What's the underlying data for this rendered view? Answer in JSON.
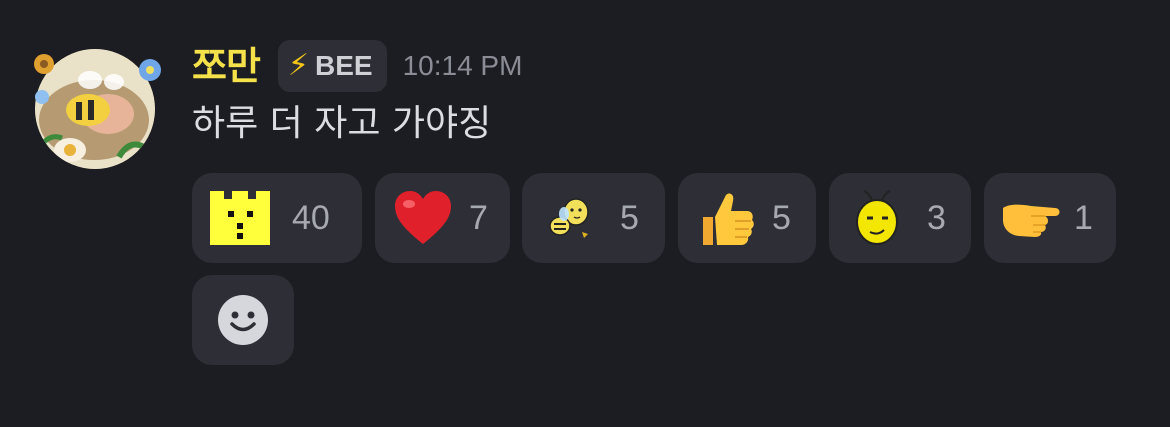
{
  "message": {
    "username": "쪼만",
    "tag": {
      "icon": "lightning-icon",
      "label": "BEE",
      "icon_char": "⚡"
    },
    "timestamp": "10:14 PM",
    "content": "하루 더 자고 가야징",
    "username_color": "#f5e14a"
  },
  "reactions": [
    {
      "emoji": "yellow-castle-block-emoji",
      "count": "40"
    },
    {
      "emoji": "red-heart-emoji",
      "count": "7"
    },
    {
      "emoji": "bee-character-emoji",
      "count": "5"
    },
    {
      "emoji": "thumbs-up-emoji",
      "count": "5"
    },
    {
      "emoji": "bee-face-emoji",
      "count": "3"
    },
    {
      "emoji": "pointing-hand-emoji",
      "count": "1"
    }
  ],
  "add_reaction": {
    "icon": "add-reaction-smiley-icon"
  },
  "colors": {
    "background": "#1c1d22",
    "pill": "#2e2f36",
    "count_text": "#a7a9b1",
    "timestamp": "#8b8d96"
  }
}
